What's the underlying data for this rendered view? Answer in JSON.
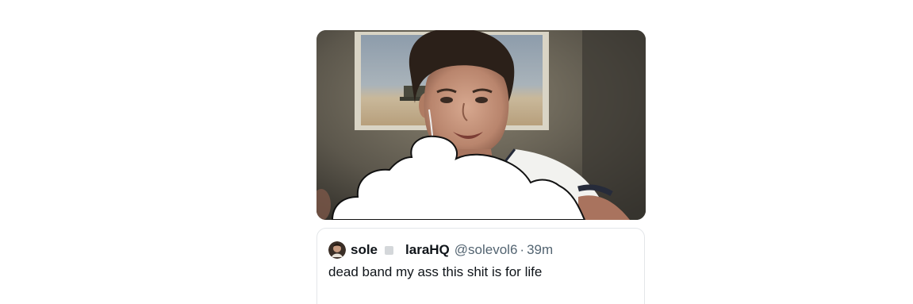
{
  "quote": {
    "display_name": "sole",
    "second_name": "laraHQ",
    "handle": "@solevol6",
    "separator": "·",
    "time": "39m",
    "text": "dead band my ass this shit is for life"
  },
  "media": {
    "type": "video-still",
    "overlay": "white speech-cloud drawn over the lower part of the frame"
  },
  "colors": {
    "name_text": "#0f1419",
    "muted_text": "#536471",
    "card_border": "#e3e6e9"
  },
  "icons": {
    "badge": "square-badge-icon"
  }
}
